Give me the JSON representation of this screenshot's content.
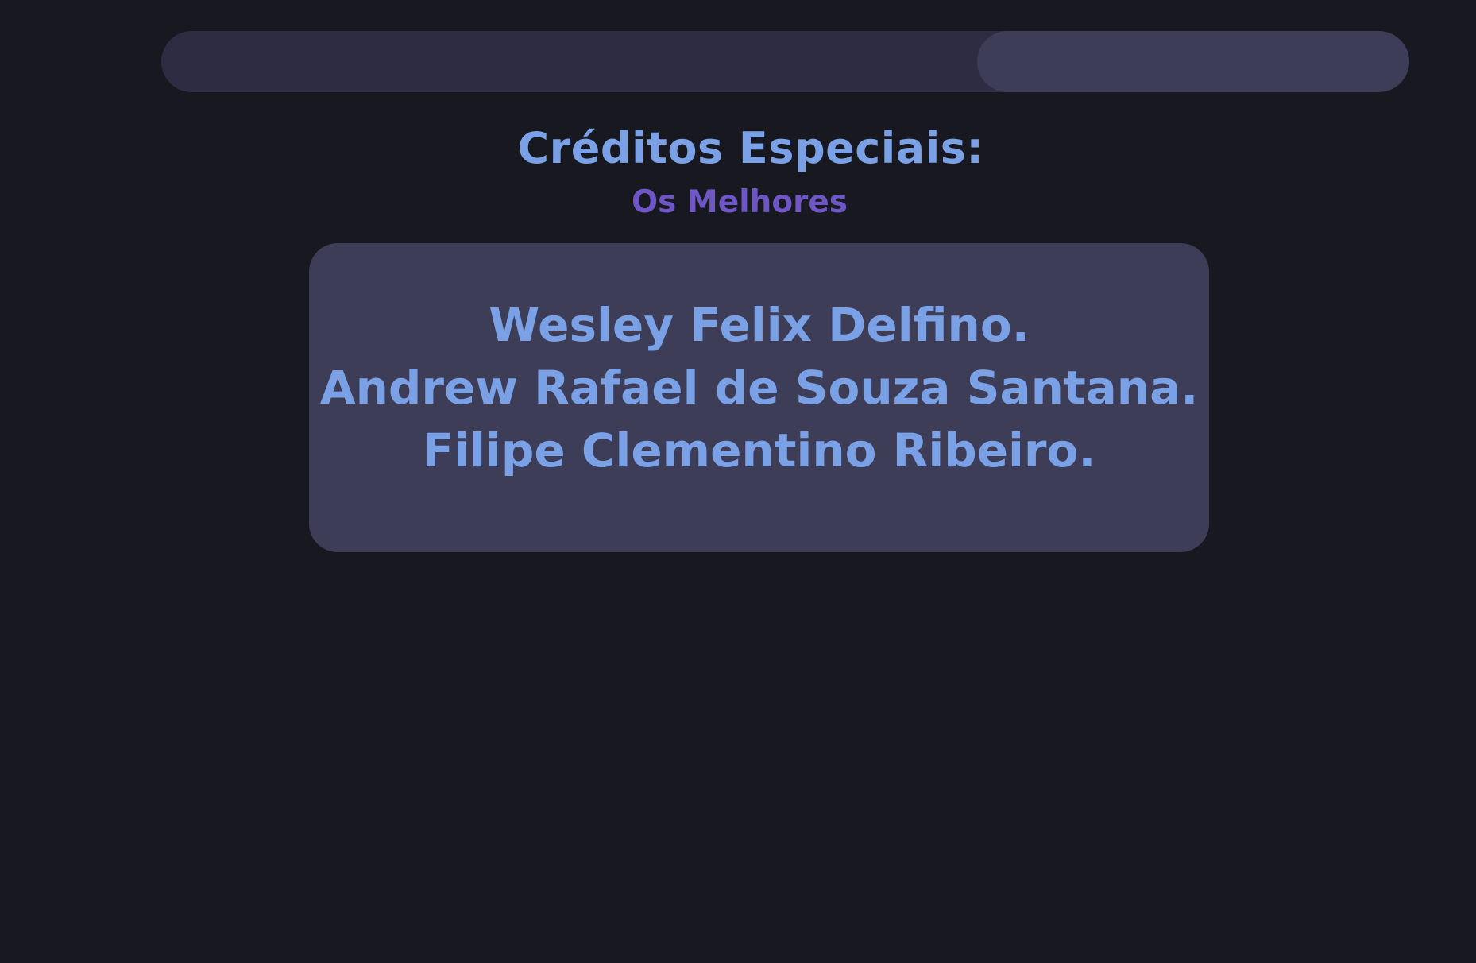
{
  "header": {
    "title": "Créditos Especiais:",
    "subtitle": "Os Melhores"
  },
  "credits": [
    "Wesley Felix Delfino.",
    "Andrew Rafael de Souza Santana.",
    "Filipe Clementino Ribeiro."
  ],
  "colors": {
    "background": "#181820",
    "bar": "#2d2c43",
    "card": "#3e3d58",
    "title": "#7aa1e6",
    "subtitle": "#6e56c6"
  }
}
